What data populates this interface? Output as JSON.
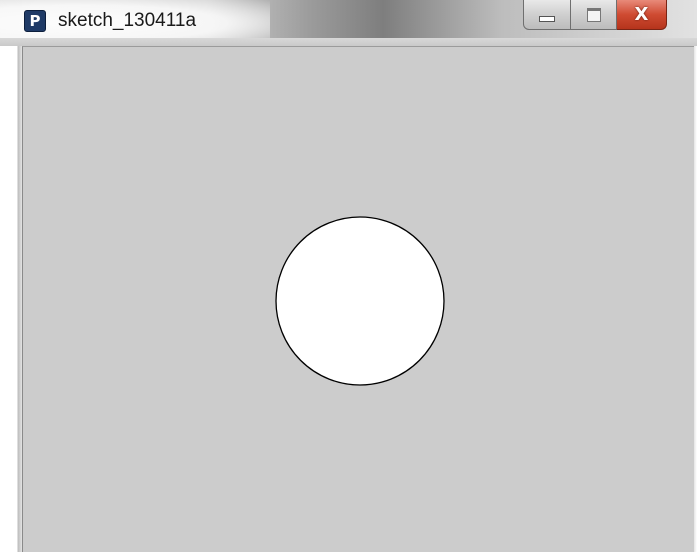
{
  "window": {
    "title": "sketch_130411a",
    "app_icon_letter": "P",
    "buttons": {
      "minimize_icon": "minimize-icon",
      "maximize_icon": "maximize-icon",
      "close_icon": "close-icon",
      "close_glyph": "X"
    }
  },
  "canvas": {
    "background": "#cccccc",
    "shape": {
      "type": "circle",
      "fill": "#ffffff",
      "stroke": "#000000"
    }
  }
}
